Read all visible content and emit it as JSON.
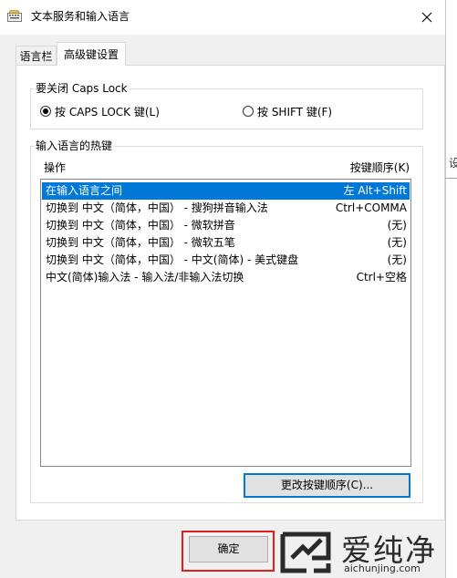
{
  "window": {
    "title": "文本服务和输入语言",
    "close_icon": "close-icon"
  },
  "tabs": [
    {
      "label": "语言栏",
      "selected": false
    },
    {
      "label": "高级键设置",
      "selected": true
    }
  ],
  "capslock_group": {
    "legend": "要关闭 Caps Lock",
    "options": [
      {
        "label": "按 CAPS LOCK 键(L)",
        "checked": true
      },
      {
        "label": "按 SHIFT 键(F)",
        "checked": false
      }
    ]
  },
  "hotkeys_group": {
    "legend": "输入语言的热键",
    "column_action": "操作",
    "column_sequence": "按键顺序(K)",
    "rows": [
      {
        "action": "在输入语言之间",
        "keys": "左 Alt+Shift",
        "selected": true
      },
      {
        "action": "切换到 中文（简体，中国） - 搜狗拼音输入法",
        "keys": "Ctrl+COMMA",
        "selected": false
      },
      {
        "action": "切换到 中文（简体，中国） - 微软拼音",
        "keys": "(无)",
        "selected": false
      },
      {
        "action": "切换到 中文（简体，中国） - 微软五笔",
        "keys": "(无)",
        "selected": false
      },
      {
        "action": "切换到 中文（简体，中国） - 中文(简体) - 美式键盘",
        "keys": "(无)",
        "selected": false
      },
      {
        "action": "中文(简体)输入法 - 输入法/非输入法切换",
        "keys": "Ctrl+空格",
        "selected": false
      }
    ],
    "change_button": "更改按键顺序(C)..."
  },
  "footer": {
    "ok_button": "确定"
  },
  "background_window": {
    "partial_text": "设"
  },
  "watermark": {
    "brand": "爱纯净",
    "url": "aichunjing.com"
  },
  "colors": {
    "accent": "#0078d7",
    "highlight_box": "#e02020"
  }
}
